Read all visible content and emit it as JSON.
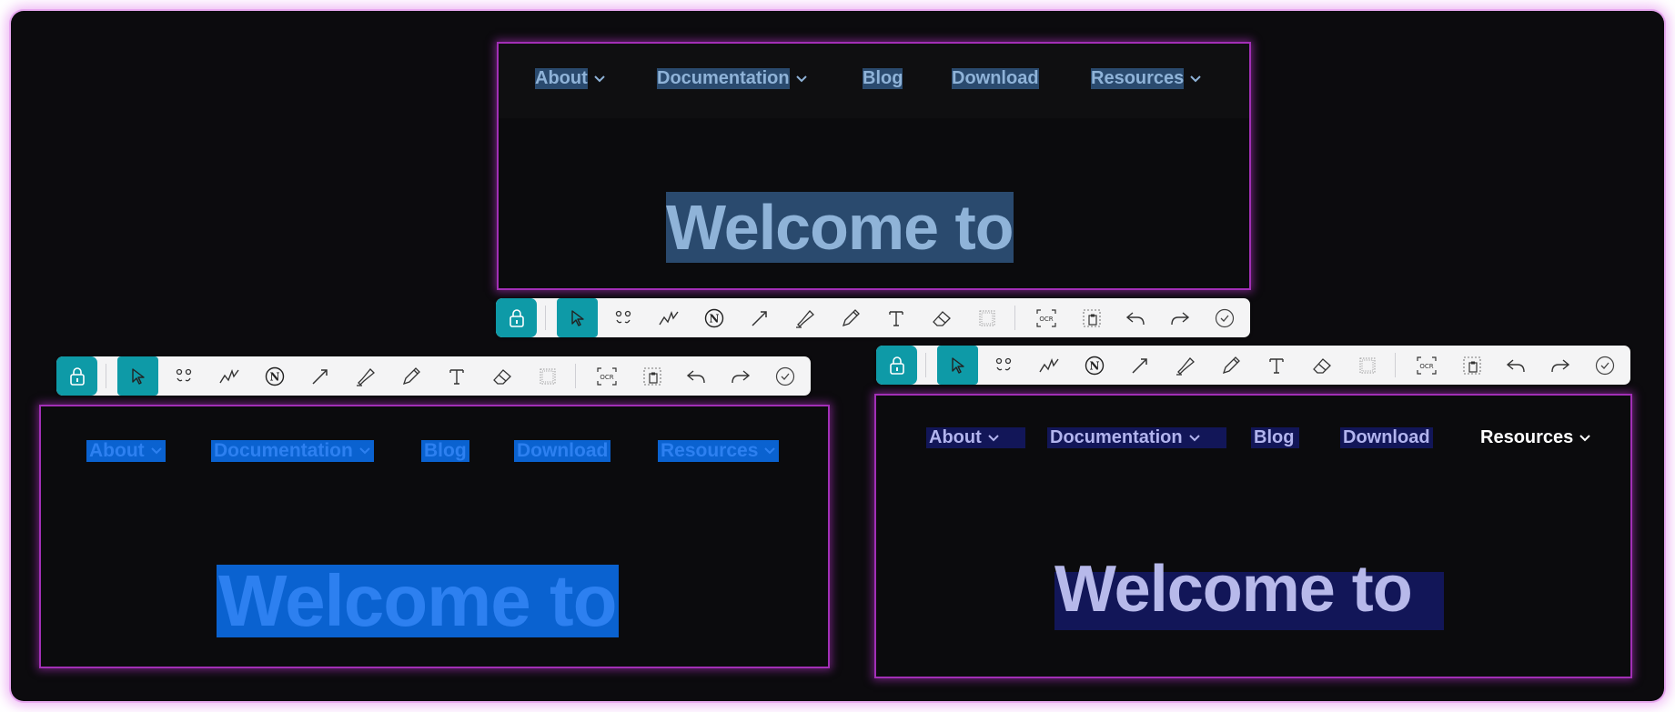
{
  "nav": {
    "about": "About",
    "documentation": "Documentation",
    "blog": "Blog",
    "download": "Download",
    "resources": "Resources"
  },
  "hero": {
    "heading": "Welcome to"
  },
  "toolbar": {
    "ocr_label": "OCR",
    "notion_letter": "N",
    "tools": [
      "lock-icon",
      "pointer-icon",
      "select-region-icon",
      "line-icon",
      "notion-icon",
      "arrow-icon",
      "marker-icon",
      "pencil-icon",
      "text-icon",
      "eraser-icon",
      "mosaic-icon",
      "ocr-icon",
      "clipboard-icon",
      "undo-icon",
      "redo-icon",
      "confirm-icon"
    ]
  },
  "colors": {
    "accent": "#0e9aa7",
    "frame_glow": "#df78eb",
    "pane_border": "#a22fb6",
    "highlight_top": "#2a4a6e",
    "highlight_left": "#0a62d0",
    "highlight_right": "#121658"
  }
}
